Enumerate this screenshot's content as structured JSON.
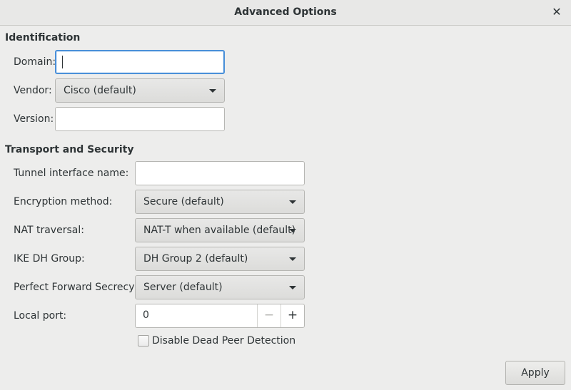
{
  "window": {
    "title": "Advanced Options",
    "close_glyph": "✕"
  },
  "identification": {
    "heading": "Identification",
    "domain_label": "Domain:",
    "domain_value": "",
    "vendor_label": "Vendor:",
    "vendor_value": "Cisco (default)",
    "version_label": "Version:",
    "version_value": ""
  },
  "transport": {
    "heading": "Transport and Security",
    "tunnel_label": "Tunnel interface name:",
    "tunnel_value": "",
    "encryption_label": "Encryption method:",
    "encryption_value": "Secure (default)",
    "nat_label": "NAT traversal:",
    "nat_value": "NAT-T when available (default)",
    "ike_label": "IKE DH Group:",
    "ike_value": "DH Group 2 (default)",
    "pfs_label": "Perfect Forward Secrecy:",
    "pfs_value": "Server (default)",
    "port_label": "Local port:",
    "port_value": "0",
    "dpd_label": "Disable Dead Peer Detection",
    "dpd_checked": false
  },
  "footer": {
    "apply_label": "Apply"
  },
  "icons": {
    "dropdown": "chevron-down-icon",
    "minus": "minus-icon",
    "plus": "plus-icon",
    "close": "close-icon"
  },
  "colors": {
    "focus": "#4a90d9",
    "background": "#ededec"
  }
}
